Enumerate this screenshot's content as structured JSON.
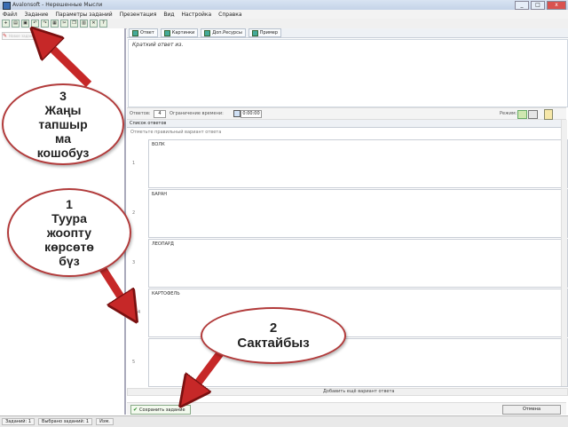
{
  "window": {
    "title": "Avalonsoft - Нерешенные Мысли",
    "minimize": "_",
    "maximize": "□",
    "close": "x"
  },
  "menu": [
    "Файл",
    "Задание",
    "Параметры заданий",
    "Презентация",
    "Вид",
    "Настройка",
    "Справка"
  ],
  "toolbar_icons": [
    "new-icon",
    "open-icon",
    "save-icon",
    "undo-icon",
    "redo-icon",
    "print-icon",
    "cut-icon",
    "copy-icon",
    "paste-icon",
    "delete-icon",
    "help-icon"
  ],
  "left_panel": {
    "new_task_label": "Новое задание"
  },
  "tabs": [
    {
      "label": "Ответ"
    },
    {
      "label": "Картинки"
    },
    {
      "label": "Доп.Ресурсы"
    },
    {
      "label": "Пример"
    }
  ],
  "question": {
    "text": "Краткий ответ из."
  },
  "options": {
    "answer_count_label": "Ответов:",
    "answer_count": "4",
    "time_label": "Ограничение времени:",
    "time_value": "0:00:00",
    "mode_label": "Режим:"
  },
  "answers": {
    "header": "Список ответов",
    "subheader": "Отметьте правильный вариант ответа",
    "rows": [
      {
        "num": "1",
        "text": "ВОЛК"
      },
      {
        "num": "2",
        "text": "БАРАН"
      },
      {
        "num": "3",
        "text": "ЛЕОПАРД"
      },
      {
        "num": "4",
        "text": "КАРТОФЕЛЬ"
      },
      {
        "num": "5",
        "text": ""
      }
    ]
  },
  "hscroll_label": "Добавить ещё вариант ответа",
  "buttons": {
    "save": "Сохранить задание",
    "cancel": "Отмена"
  },
  "statusbar": [
    "Заданий: 1",
    "Выбрано заданий: 1",
    "Изм."
  ],
  "annotations": [
    {
      "num": "3",
      "text": "Жаңы\nтапшыр\nма\nкошобуз"
    },
    {
      "num": "1",
      "text": "Туура\nжоопту\nкөрсөтө\nбүз"
    },
    {
      "num": "2",
      "text": "Сактайбыз"
    }
  ],
  "colors": {
    "arrow": "#c62828",
    "bubble_border": "#b23b3b",
    "accent": "#3a6db3"
  }
}
